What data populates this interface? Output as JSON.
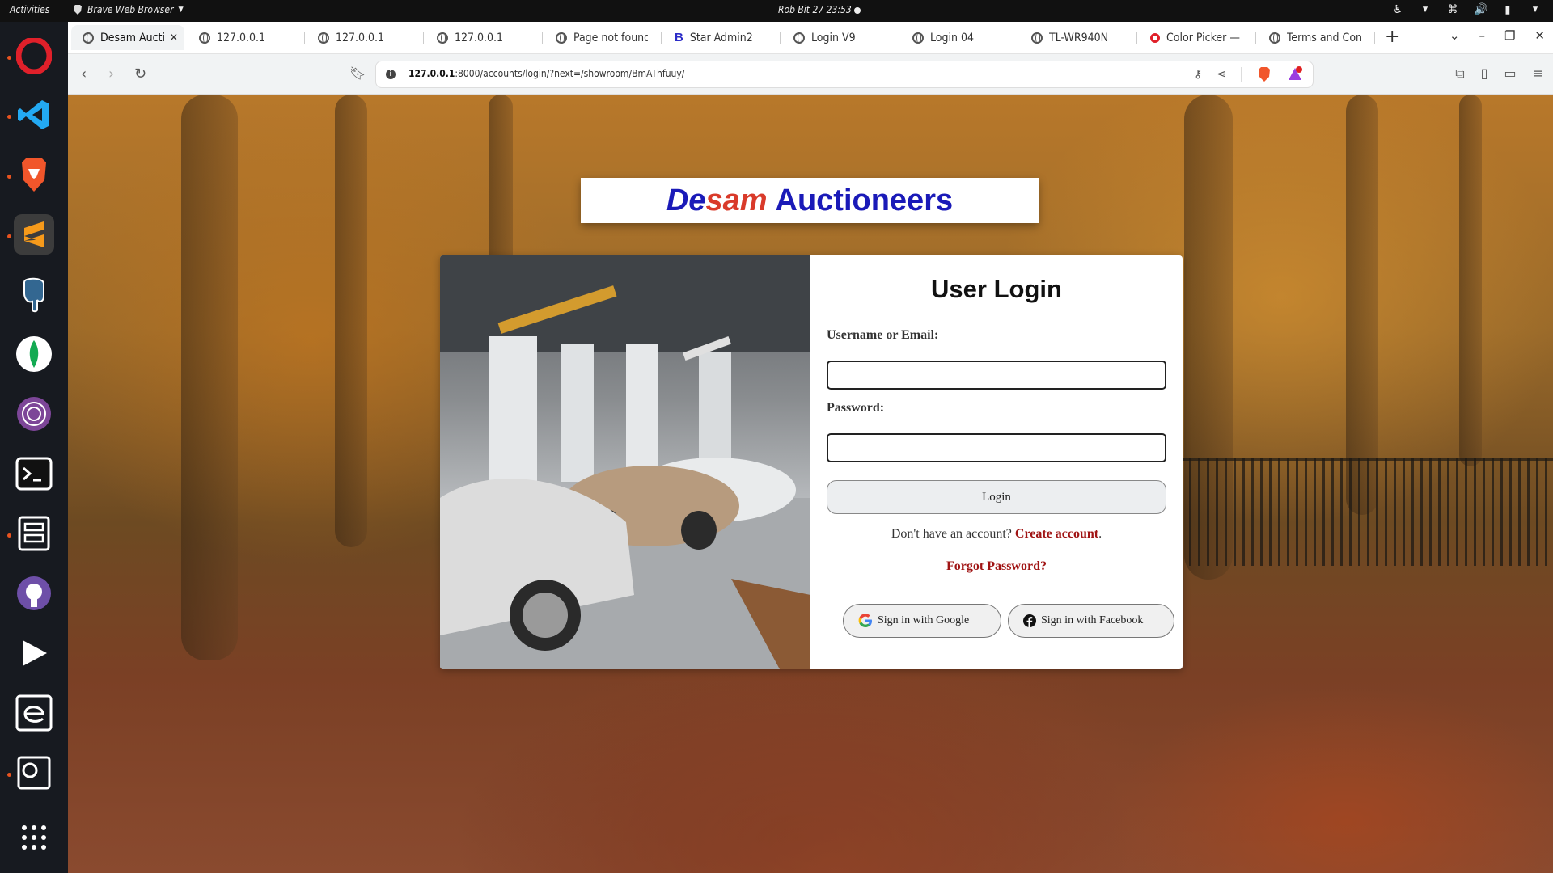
{
  "topbar": {
    "activities": "Activities",
    "app_name": "Brave Web Browser",
    "clock": "Rob Bit 27  23:53"
  },
  "browser": {
    "tabs": [
      {
        "label": "Desam Aucti",
        "icon": "globe-icon",
        "active": true
      },
      {
        "label": "127.0.0.1",
        "icon": "globe-icon"
      },
      {
        "label": "127.0.0.1",
        "icon": "globe-icon"
      },
      {
        "label": "127.0.0.1",
        "icon": "globe-icon"
      },
      {
        "label": "Page not found",
        "icon": "globe-icon"
      },
      {
        "label": "Star Admin2",
        "icon": "bootstrap-icon"
      },
      {
        "label": "Login V9",
        "icon": "globe-icon"
      },
      {
        "label": "Login 04",
        "icon": "globe-icon"
      },
      {
        "label": "TL-WR940N",
        "icon": "globe-icon"
      },
      {
        "label": "Color Picker — H",
        "icon": "opera-icon"
      },
      {
        "label": "Terms and Cond",
        "icon": "globe-icon"
      }
    ],
    "new_tab": "+",
    "url_host": "127.0.0.1",
    "url_rest": ":8000/accounts/login/?next=/showroom/BmAThfuuy/"
  },
  "page": {
    "brand": {
      "part1": "De",
      "part2": "sam",
      "part3": "Auctioneers"
    },
    "form": {
      "title": "User Login",
      "username_label": "Username or Email:",
      "username_value": "",
      "password_label": "Password:",
      "password_value": "",
      "login_button": "Login",
      "signup_prefix": "Don't have an account?",
      "signup_link": "Create account",
      "signup_suffix": ".",
      "forgot_link": "Forgot Password?",
      "google_button": "Sign in with Google",
      "facebook_button": "Sign in with Facebook"
    }
  },
  "colors": {
    "brand_blue": "#1a1ab8",
    "brand_red": "#d93a2a",
    "link_red": "#a01414"
  }
}
